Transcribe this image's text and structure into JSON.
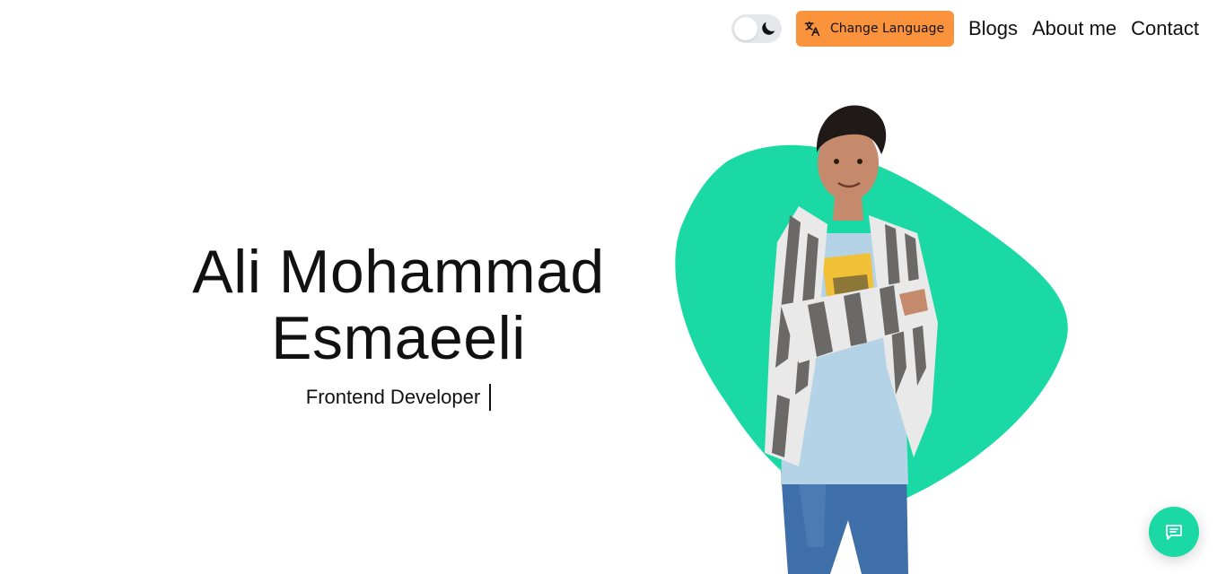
{
  "header": {
    "theme_toggle": {
      "state": "light",
      "icon": "moon-icon"
    },
    "language_button": {
      "label": "Change Language",
      "icon": "translate-icon",
      "color": "#fb923c"
    },
    "nav_links": [
      {
        "label": "Blogs"
      },
      {
        "label": "About me"
      },
      {
        "label": "Contact"
      }
    ]
  },
  "hero": {
    "name_line1": "Ali Mohammad",
    "name_line2": "Esmaeeli",
    "role": "Frontend Developer"
  },
  "colors": {
    "accent": "#1ad9a4",
    "language_button": "#fb923c",
    "toggle_track": "#e5e7eb"
  },
  "chat": {
    "icon": "chat-bubble-icon"
  }
}
